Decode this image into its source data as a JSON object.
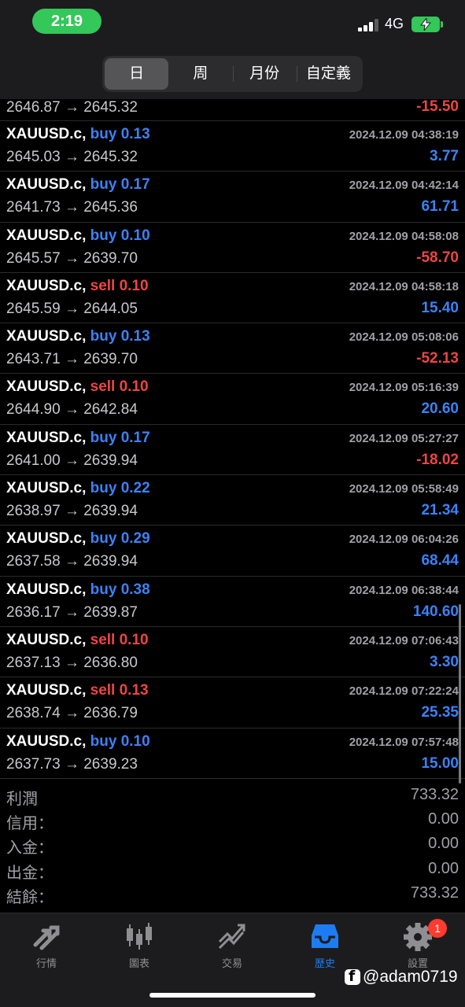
{
  "status": {
    "time": "2:19",
    "network": "4G"
  },
  "segments": [
    {
      "label": "日",
      "active": true
    },
    {
      "label": "周",
      "active": false
    },
    {
      "label": "月份",
      "active": false
    },
    {
      "label": "自定義",
      "active": false
    }
  ],
  "partial_row": {
    "prices": "2646.87 → 2645.32",
    "profit": "-15.50"
  },
  "trades": [
    {
      "symbol": "XAUUSD.c,",
      "side": "buy 0.13",
      "date": "2024.12.09 04:38:19",
      "prices": "2645.03 → 2645.32",
      "profit": "3.77"
    },
    {
      "symbol": "XAUUSD.c,",
      "side": "buy 0.17",
      "date": "2024.12.09 04:42:14",
      "prices": "2641.73 → 2645.36",
      "profit": "61.71"
    },
    {
      "symbol": "XAUUSD.c,",
      "side": "buy 0.10",
      "date": "2024.12.09 04:58:08",
      "prices": "2645.57 → 2639.70",
      "profit": "-58.70"
    },
    {
      "symbol": "XAUUSD.c,",
      "side": "sell 0.10",
      "date": "2024.12.09 04:58:18",
      "prices": "2645.59 → 2644.05",
      "profit": "15.40"
    },
    {
      "symbol": "XAUUSD.c,",
      "side": "buy 0.13",
      "date": "2024.12.09 05:08:06",
      "prices": "2643.71 → 2639.70",
      "profit": "-52.13"
    },
    {
      "symbol": "XAUUSD.c,",
      "side": "sell 0.10",
      "date": "2024.12.09 05:16:39",
      "prices": "2644.90 → 2642.84",
      "profit": "20.60"
    },
    {
      "symbol": "XAUUSD.c,",
      "side": "buy 0.17",
      "date": "2024.12.09 05:27:27",
      "prices": "2641.00 → 2639.94",
      "profit": "-18.02"
    },
    {
      "symbol": "XAUUSD.c,",
      "side": "buy 0.22",
      "date": "2024.12.09 05:58:49",
      "prices": "2638.97 → 2639.94",
      "profit": "21.34"
    },
    {
      "symbol": "XAUUSD.c,",
      "side": "buy 0.29",
      "date": "2024.12.09 06:04:26",
      "prices": "2637.58 → 2639.94",
      "profit": "68.44"
    },
    {
      "symbol": "XAUUSD.c,",
      "side": "buy 0.38",
      "date": "2024.12.09 06:38:44",
      "prices": "2636.17 → 2639.87",
      "profit": "140.60"
    },
    {
      "symbol": "XAUUSD.c,",
      "side": "sell 0.10",
      "date": "2024.12.09 07:06:43",
      "prices": "2637.13 → 2636.80",
      "profit": "3.30"
    },
    {
      "symbol": "XAUUSD.c,",
      "side": "sell 0.13",
      "date": "2024.12.09 07:22:24",
      "prices": "2638.74 → 2636.79",
      "profit": "25.35"
    },
    {
      "symbol": "XAUUSD.c,",
      "side": "buy 0.10",
      "date": "2024.12.09 07:57:48",
      "prices": "2637.73 → 2639.23",
      "profit": "15.00"
    }
  ],
  "summary": [
    {
      "label": "利潤",
      "value": "733.32"
    },
    {
      "label": "信用：",
      "value": "0.00"
    },
    {
      "label": "入金：",
      "value": "0.00"
    },
    {
      "label": "出金：",
      "value": "0.00"
    },
    {
      "label": "結餘：",
      "value": "733.32"
    }
  ],
  "tabs": [
    {
      "label": "行情",
      "icon": "quotes-arrows-icon",
      "active": false
    },
    {
      "label": "圖表",
      "icon": "candlestick-chart-icon",
      "active": false
    },
    {
      "label": "交易",
      "icon": "trade-chart-icon",
      "active": false
    },
    {
      "label": "歷史",
      "icon": "history-tray-icon",
      "active": true
    },
    {
      "label": "設置",
      "icon": "gear-icon",
      "active": false,
      "badge": "1"
    }
  ],
  "watermark": "@adam0719",
  "colors": {
    "buy": "#3b82f6",
    "sell": "#ef4444",
    "active_tab": "#1e7cf2",
    "inactive": "#8e8e93"
  }
}
